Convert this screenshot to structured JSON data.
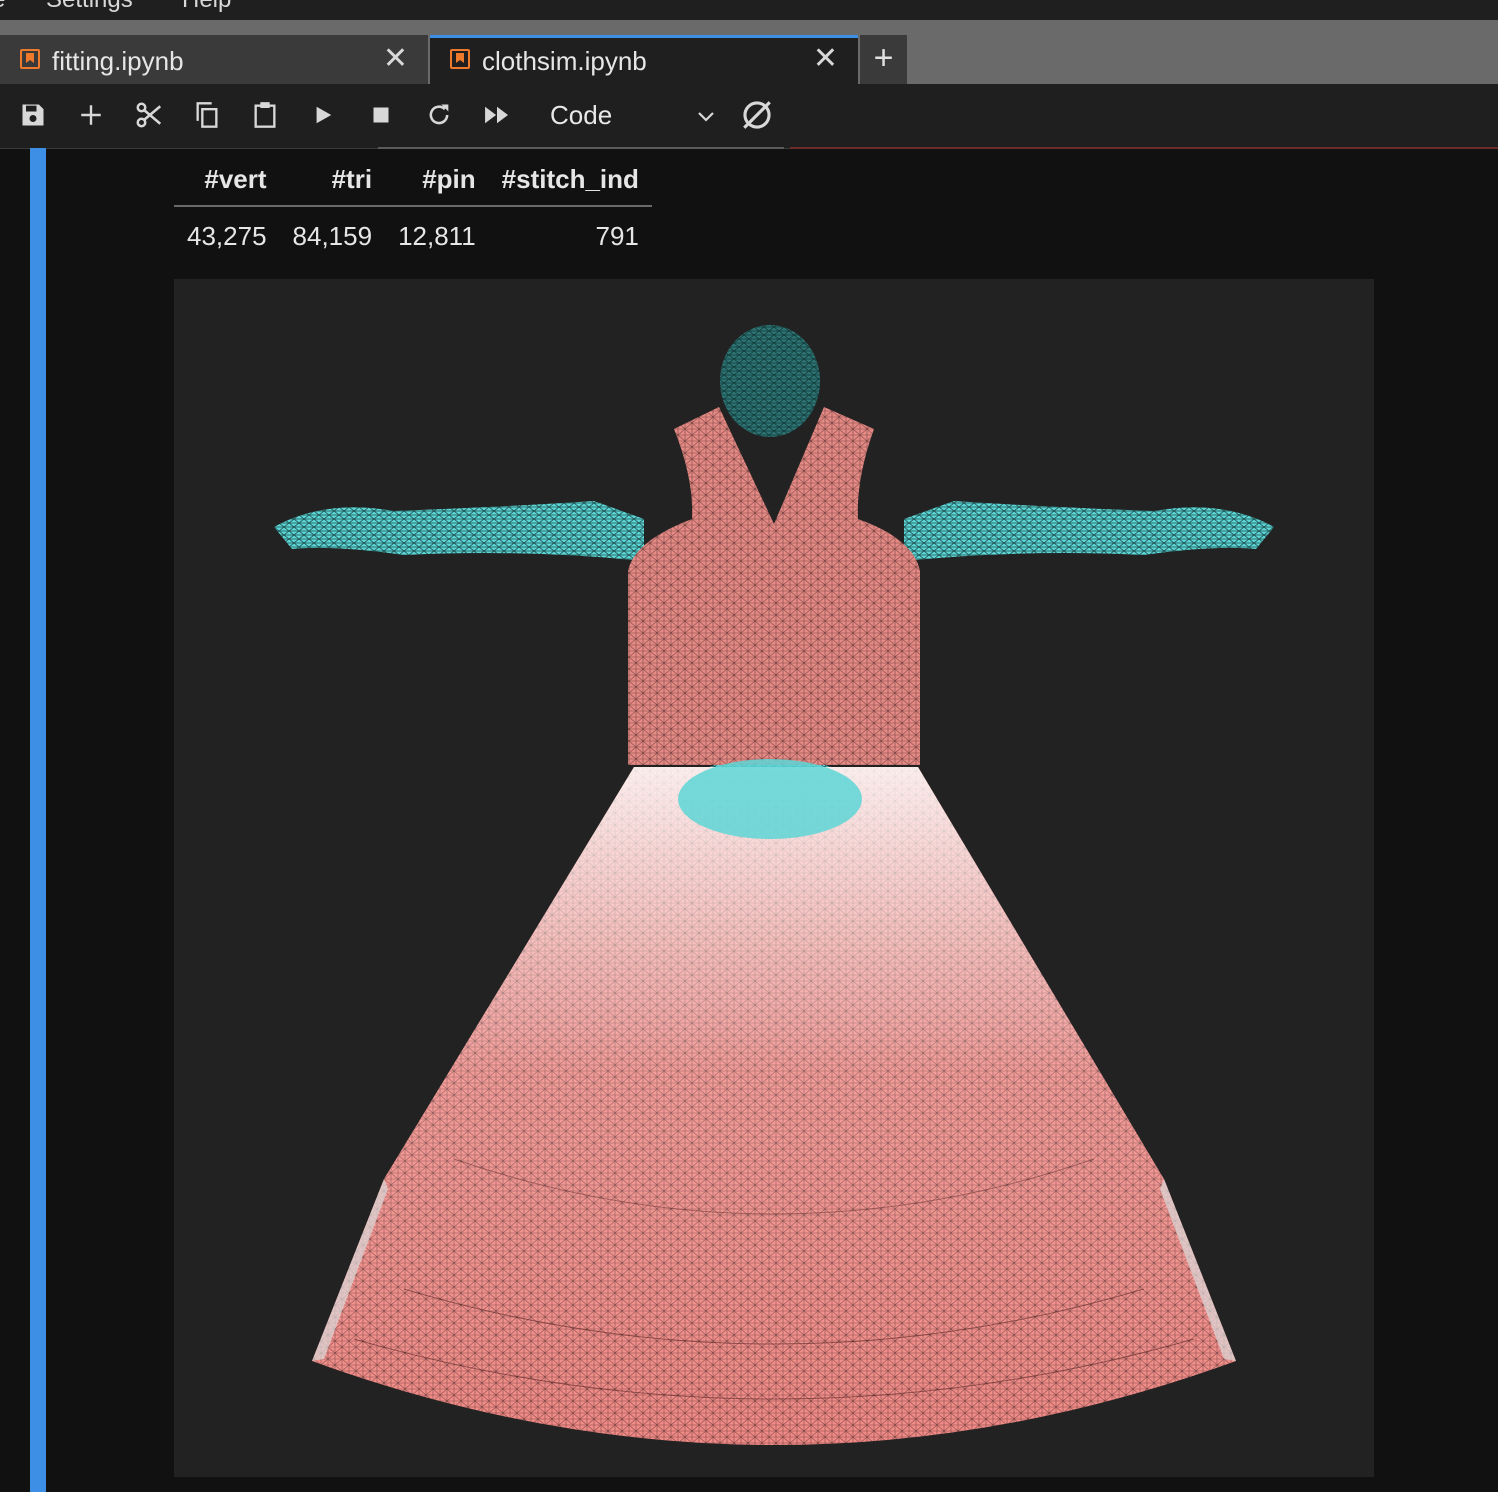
{
  "menubar": {
    "items": [
      "e",
      "Settings",
      "Help"
    ]
  },
  "tabs": [
    {
      "label": "fitting.ipynb",
      "active": false
    },
    {
      "label": "clothsim.ipynb",
      "active": true
    }
  ],
  "toolbar": {
    "icons": [
      "save-icon",
      "add-icon",
      "cut-icon",
      "copy-icon",
      "paste-icon",
      "run-icon",
      "stop-icon",
      "restart-icon",
      "run-all-icon",
      "kernel-status-icon"
    ],
    "cell_type": "Code"
  },
  "colors": {
    "accent": "#3d8fe6",
    "tab_icon": "#f07a2c",
    "cloth": "#f08080",
    "body": "#5ed6d6"
  },
  "stats_table": {
    "headers": [
      "#vert",
      "#tri",
      "#pin",
      "#stitch_ind"
    ],
    "rows": [
      [
        "43,275",
        "84,159",
        "12,811",
        "791"
      ]
    ]
  }
}
